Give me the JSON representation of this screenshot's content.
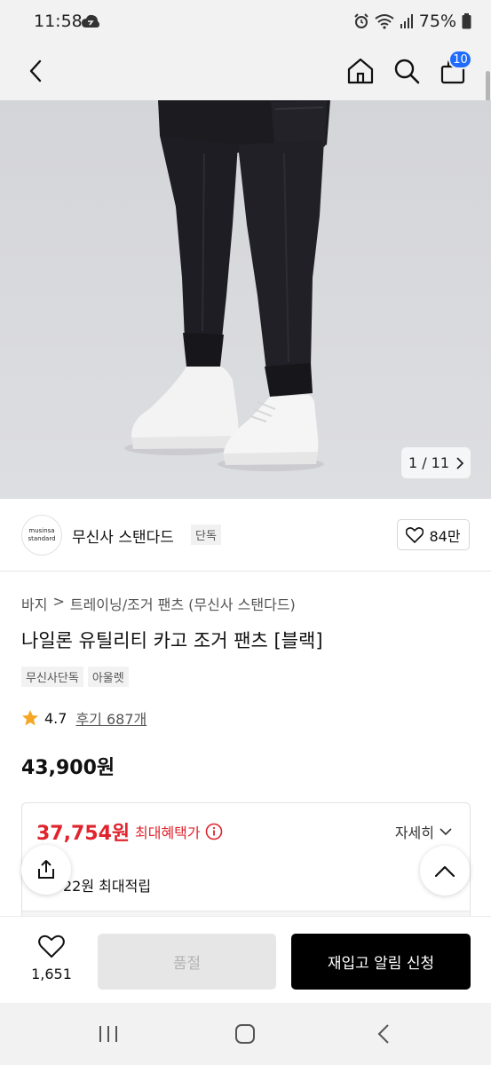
{
  "status_bar": {
    "time": "11:58",
    "battery": "75%"
  },
  "header": {
    "cart_count": "10"
  },
  "gallery": {
    "counter": "1 / 11"
  },
  "brand": {
    "logo_line1": "musinsa",
    "logo_line2": "standard",
    "name": "무신사 스탠다드",
    "badge": "단독",
    "likes": "84만"
  },
  "breadcrumb": {
    "first": "바지",
    "second": "트레이닝/조거 팬츠 (무신사 스탠다드)"
  },
  "product": {
    "title": "나일론 유틸리티 카고 조거 팬츠 [블랙]",
    "tags": [
      "무신사단독",
      "아울렛"
    ],
    "rating": "4.7",
    "reviews": "후기 687개",
    "price": "43,900원"
  },
  "benefit": {
    "price": "37,754원",
    "label": "최대혜택가",
    "detail": "자세히",
    "points": "22원 최대적립"
  },
  "bottom": {
    "wish_count": "1,651",
    "soldout_label": "품절",
    "notify_label": "재입고 알림 신청"
  },
  "colors": {
    "accent_red": "#e0242d",
    "badge_blue": "#1e6bff",
    "star": "#f5a623"
  }
}
